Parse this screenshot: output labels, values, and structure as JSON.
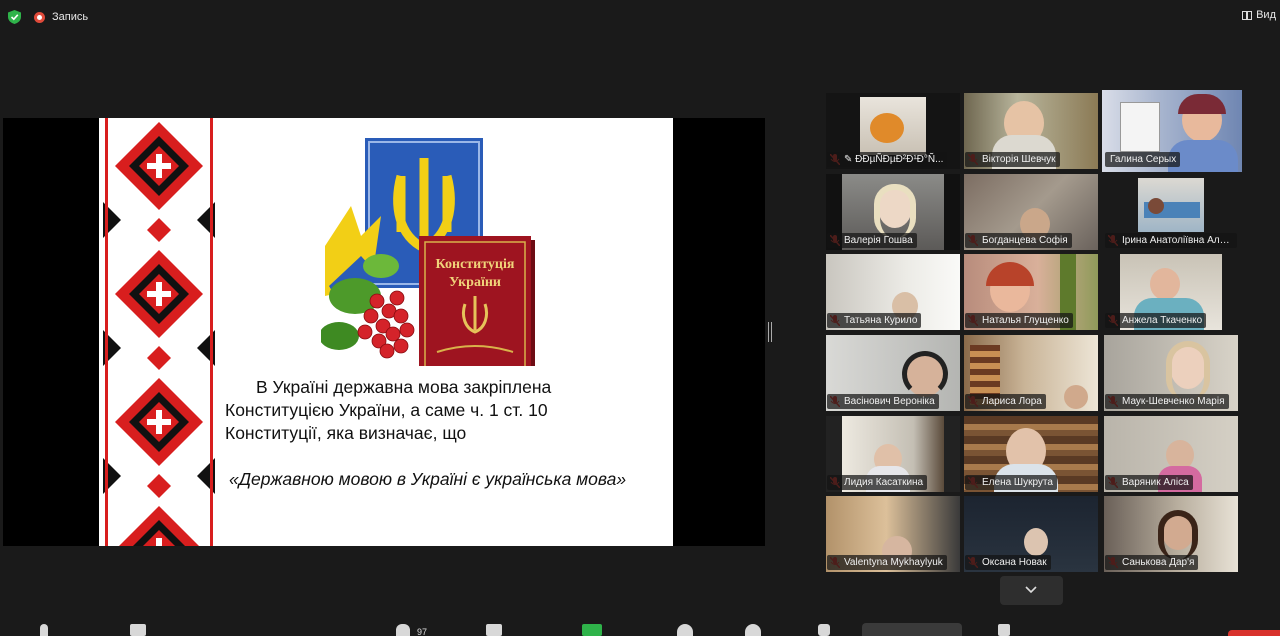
{
  "topbar": {
    "recording_label": "Запись",
    "view_label": "Вид"
  },
  "slide": {
    "book_title_1": "Конституція",
    "book_title_2": "України",
    "lines": [
      "В Україні державна мова закріплена",
      "Конституцією України, а саме ч. 1 ст. 10",
      "Конституції, яка визначає, що"
    ],
    "quote": "«Державною мовою в Україні є українська мова»"
  },
  "participants": [
    {
      "name": "ÐÐµÑÐµÐ²Ð¹Ð°Ñ...",
      "pinned": true
    },
    {
      "name": "Вікторія Шевчук"
    },
    {
      "name": "Галина Серых",
      "active": true
    },
    {
      "name": "Валерія Гошва"
    },
    {
      "name": "Богданцева Софія"
    },
    {
      "name": "Ірина Анатоліївна Але..."
    },
    {
      "name": "Татьяна Курило"
    },
    {
      "name": "Наталья Глущенко"
    },
    {
      "name": "Анжела Ткаченко"
    },
    {
      "name": "Васінович Вероніка"
    },
    {
      "name": "Лариса Лора"
    },
    {
      "name": "Маук-Шевченко Марія"
    },
    {
      "name": "Лидия Касаткина"
    },
    {
      "name": "Елена Шукрута"
    },
    {
      "name": "Варяник Аліса"
    },
    {
      "name": "Valentyna Mykhaylyuk"
    },
    {
      "name": "Оксана Новак"
    },
    {
      "name": "Санькова Дар'я"
    }
  ],
  "toolbar": {
    "participants_count": "97"
  },
  "colors": {
    "active_speaker": "#d6e84a",
    "record_dot": "#e04a3a",
    "mute_icon": "#e0362c"
  },
  "icons": [
    "shield-icon",
    "record-icon",
    "view-icon",
    "mic-muted-icon",
    "pin-icon",
    "chevron-down-icon"
  ]
}
